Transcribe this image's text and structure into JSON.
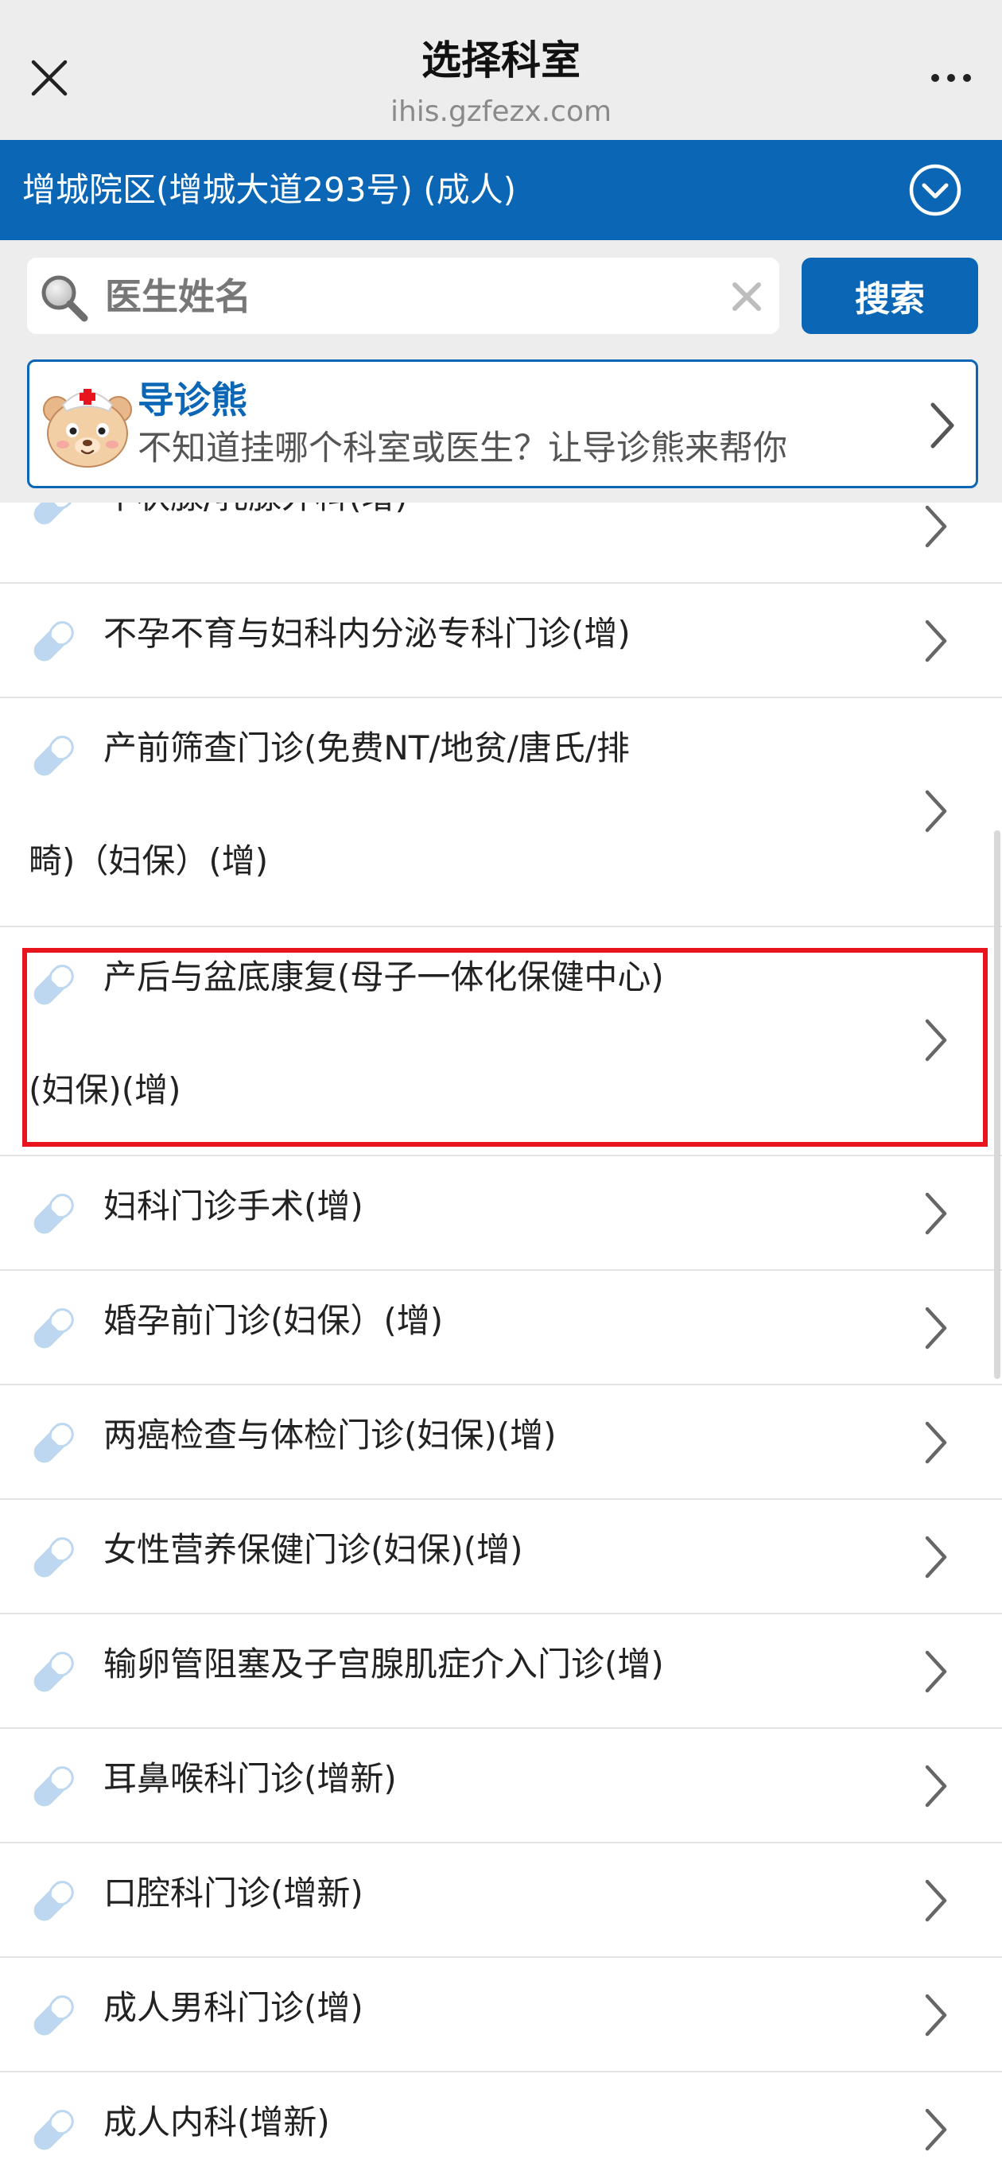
{
  "header": {
    "title": "选择科室",
    "url": "ihis.gzfezx.com"
  },
  "campus": {
    "name": "增城院区(增城大道293号) (成人)"
  },
  "search": {
    "placeholder": "医生姓名",
    "button_label": "搜索"
  },
  "guide": {
    "title": "导诊熊",
    "subtitle": "不知道挂哪个科室或医生？让导诊熊来帮你"
  },
  "departments": [
    {
      "line1": "甲状腺/乳腺外科(增)",
      "line2": ""
    },
    {
      "line1": "不孕不育与妇科内分泌专科门诊(增)",
      "line2": ""
    },
    {
      "line1": "产前筛查门诊(免费NT/地贫/唐氏/排",
      "line2": "畸)（妇保）(增)"
    },
    {
      "line1": "产后与盆底康复(母子一体化保健中心)",
      "line2": "(妇保)(增)"
    },
    {
      "line1": "妇科门诊手术(增)",
      "line2": ""
    },
    {
      "line1": "婚孕前门诊(妇保）(增)",
      "line2": ""
    },
    {
      "line1": "两癌检查与体检门诊(妇保)(增)",
      "line2": ""
    },
    {
      "line1": "女性营养保健门诊(妇保)(增)",
      "line2": ""
    },
    {
      "line1": "输卵管阻塞及子宫腺肌症介入门诊(增)",
      "line2": ""
    },
    {
      "line1": "耳鼻喉科门诊(增新)",
      "line2": ""
    },
    {
      "line1": "口腔科门诊(增新)",
      "line2": ""
    },
    {
      "line1": "成人男科门诊(增)",
      "line2": ""
    },
    {
      "line1": "成人内科(增新)",
      "line2": ""
    }
  ],
  "icons": {
    "close": "close-icon",
    "more": "more-icon",
    "campus_toggle": "chevron-down-circle-icon",
    "search": "search-icon",
    "clear": "clear-icon",
    "guide": "bear-mascot-icon",
    "department": "pill-icon",
    "row_arrow": "chevron-right-icon"
  },
  "colors": {
    "primary": "#0b67b5",
    "highlight": "#e8141e",
    "pill": "#bcd7ef"
  }
}
